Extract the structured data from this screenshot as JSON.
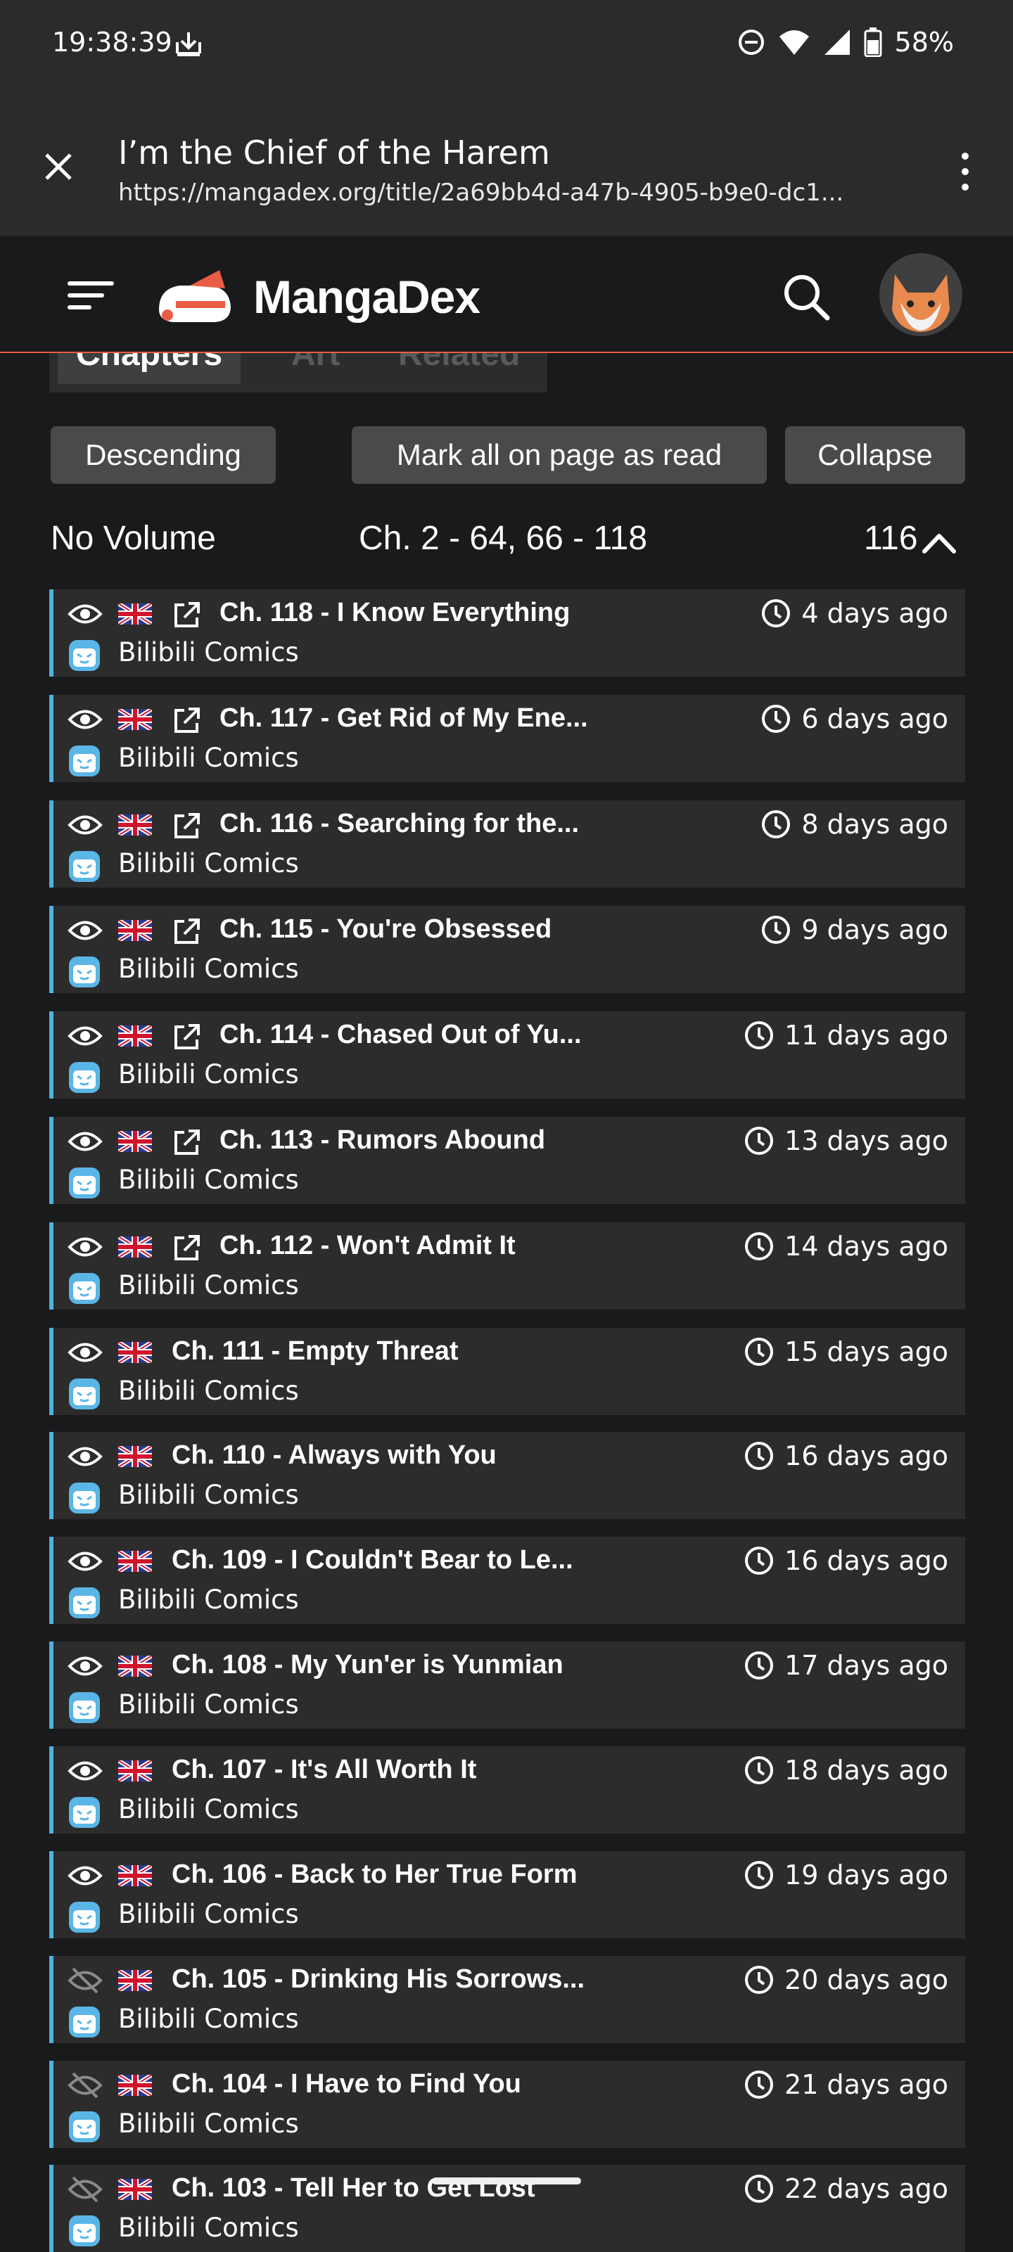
{
  "status": {
    "time": "19:38:39",
    "battery": "58%"
  },
  "browser": {
    "title": "I’m the Chief of the Harem",
    "url": "https://mangadex.org/title/2a69bb4d-a47b-4905-b9e0-dc1..."
  },
  "nav": {
    "brand": "MangaDex"
  },
  "tabs": [
    "Chapters",
    "Art",
    "Related"
  ],
  "controls": {
    "sort_label": "Descending",
    "mark_read_label": "Mark all on page as read",
    "collapse_label": "Collapse"
  },
  "volume": {
    "name": "No Volume",
    "range": "Ch. 2 - 64, 66 - 118",
    "count": "116"
  },
  "chapters": [
    {
      "title": "Ch. 118 - I Know Everything",
      "time": "4 days ago",
      "group": "Bilibili Comics",
      "external": true,
      "read": false
    },
    {
      "title": "Ch. 117 - Get Rid of My Ene...",
      "time": "6 days ago",
      "group": "Bilibili Comics",
      "external": true,
      "read": false
    },
    {
      "title": "Ch. 116 - Searching for the...",
      "time": "8 days ago",
      "group": "Bilibili Comics",
      "external": true,
      "read": false
    },
    {
      "title": "Ch. 115 - You're Obsessed",
      "time": "9 days ago",
      "group": "Bilibili Comics",
      "external": true,
      "read": false
    },
    {
      "title": "Ch. 114 - Chased Out of Yu...",
      "time": "11 days ago",
      "group": "Bilibili Comics",
      "external": true,
      "read": false
    },
    {
      "title": "Ch. 113 - Rumors Abound",
      "time": "13 days ago",
      "group": "Bilibili Comics",
      "external": true,
      "read": false
    },
    {
      "title": "Ch. 112 - Won't Admit It",
      "time": "14 days ago",
      "group": "Bilibili Comics",
      "external": true,
      "read": false
    },
    {
      "title": "Ch. 111 - Empty Threat",
      "time": "15 days ago",
      "group": "Bilibili Comics",
      "external": false,
      "read": false
    },
    {
      "title": "Ch. 110 - Always with You",
      "time": "16 days ago",
      "group": "Bilibili Comics",
      "external": false,
      "read": false
    },
    {
      "title": "Ch. 109 - I Couldn't Bear to Le...",
      "time": "16 days ago",
      "group": "Bilibili Comics",
      "external": false,
      "read": false
    },
    {
      "title": "Ch. 108 - My Yun'er is Yunmian",
      "time": "17 days ago",
      "group": "Bilibili Comics",
      "external": false,
      "read": false
    },
    {
      "title": "Ch. 107 - It's All Worth It",
      "time": "18 days ago",
      "group": "Bilibili Comics",
      "external": false,
      "read": false
    },
    {
      "title": "Ch. 106 - Back to Her True Form",
      "time": "19 days ago",
      "group": "Bilibili Comics",
      "external": false,
      "read": false
    },
    {
      "title": "Ch. 105 - Drinking His Sorrows...",
      "time": "20 days ago",
      "group": "Bilibili Comics",
      "external": false,
      "read": true
    },
    {
      "title": "Ch. 104 - I Have to Find You",
      "time": "21 days ago",
      "group": "Bilibili Comics",
      "external": false,
      "read": true
    },
    {
      "title": "Ch. 103 - Tell Her to Get Lost",
      "time": "22 days ago",
      "group": "Bilibili Comics",
      "external": false,
      "read": true
    }
  ],
  "colors": {
    "accent": "#e95d46",
    "unread_marker": "#4fb1e0",
    "row_bg": "#2c2c2c",
    "page_bg": "#191a1c"
  },
  "icons": [
    "close-icon",
    "more-vert-icon",
    "hamburger-menu-icon",
    "mangadex-logo",
    "search-icon",
    "avatar",
    "eye-icon",
    "eye-off-icon",
    "uk-flag-icon",
    "external-link-icon",
    "clock-icon",
    "bilibili-group-icon",
    "chevron-up-icon"
  ]
}
